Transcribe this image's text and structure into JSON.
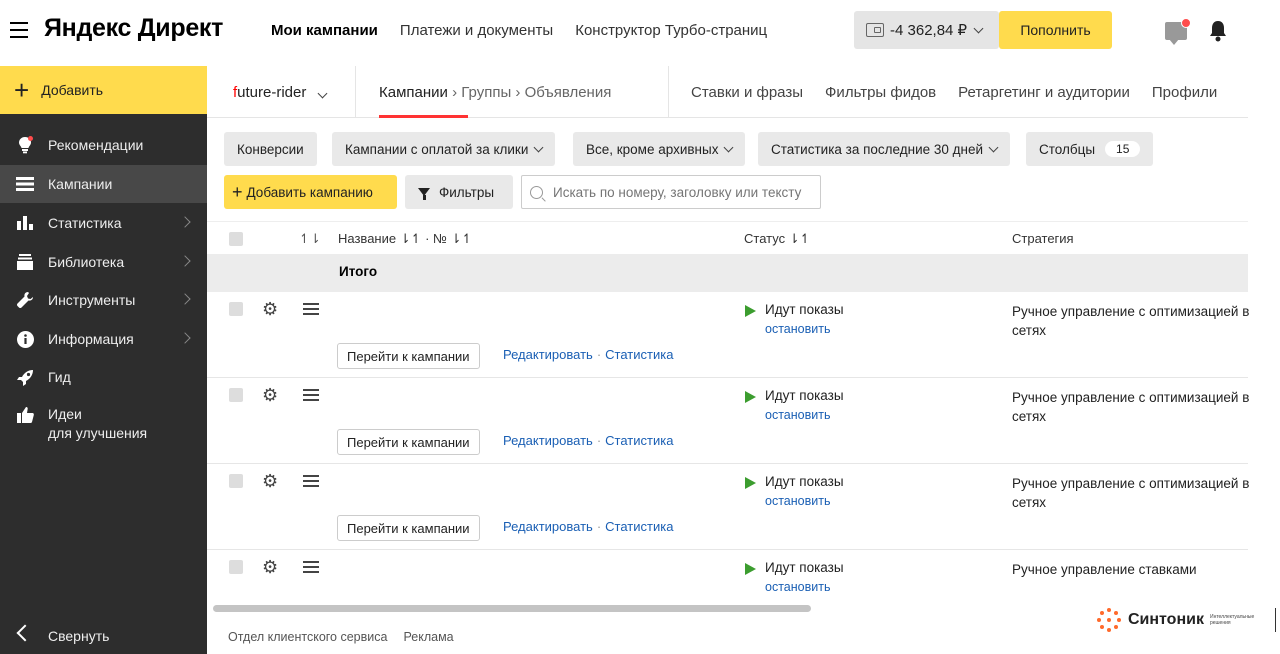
{
  "header": {
    "logo": "Яндекс Директ",
    "nav": [
      "Мои кампании",
      "Платежи и документы",
      "Конструктор Турбо-страниц"
    ],
    "balance": "-4 362,84 ₽",
    "topup_label": "Пополнить"
  },
  "sidebar": {
    "add_label": "Добавить",
    "items": [
      {
        "label": "Рекомендации",
        "icon": "bulb-icon"
      },
      {
        "label": "Кампании",
        "icon": "campaigns-icon"
      },
      {
        "label": "Статистика",
        "icon": "bar-chart-icon"
      },
      {
        "label": "Библиотека",
        "icon": "library-icon"
      },
      {
        "label": "Инструменты",
        "icon": "wrench-icon"
      },
      {
        "label": "Информация",
        "icon": "info-icon"
      },
      {
        "label": "Гид",
        "icon": "rocket-icon"
      },
      {
        "label_line1": "Идеи",
        "label_line2": "для улучшения",
        "icon": "thumbs-up-icon"
      }
    ],
    "collapse_label": "Свернуть"
  },
  "subnav": {
    "login_first": "f",
    "login_rest": "uture-rider",
    "crumb_active": "Кампании",
    "crumb_groups": "Группы",
    "crumb_ads": "Объявления",
    "tabs": [
      "Ставки и фразы",
      "Фильтры фидов",
      "Ретаргетинг и аудитории",
      "Профили"
    ]
  },
  "filters": {
    "conversions": "Конверсии",
    "click_campaigns": "Кампании с оплатой за клики",
    "except_archived": "Все, кроме архивных",
    "stats_period": "Статистика за последние 30 дней",
    "columns": "Столбцы",
    "columns_count": "15",
    "add_campaign": "Добавить кампанию",
    "filters_label": "Фильтры",
    "search_placeholder": "Искать по номеру, заголовку или тексту"
  },
  "table": {
    "sort_col": "↿⇂",
    "name_col": "Название ⇂↿ · № ⇂↿",
    "status_col": "Статус ⇂↿",
    "strategy_col": "Стратегия",
    "total_label": "Итого",
    "rows": [
      {
        "status": "Идут показы",
        "stop": "остановить",
        "strategy": "Ручное управление с оптимизацией в сетях",
        "has_actions": true
      },
      {
        "status": "Идут показы",
        "stop": "остановить",
        "strategy": "Ручное управление с оптимизацией в сетях",
        "has_actions": true
      },
      {
        "status": "Идут показы",
        "stop": "остановить",
        "strategy": "Ручное управление с оптимизацией в сетях",
        "has_actions": true
      },
      {
        "status": "Идут показы",
        "stop": "остановить",
        "strategy": "Ручное управление ставками",
        "has_actions": false
      }
    ],
    "goto_label": "Перейти к кампании",
    "edit_label": "Редактировать",
    "stats_label": "Статистика"
  },
  "footer": {
    "client_service": "Отдел клиентского сервиса",
    "ads": "Реклама"
  },
  "watermark": {
    "brand": "Синтоник",
    "tagline": "Интеллектуальные решения"
  },
  "colors": {
    "accent_yellow": "#ffdb4d",
    "sidebar_bg": "#2d2d2d",
    "link_blue": "#1a5fb4",
    "status_green": "#3c9d2f",
    "active_tab_red": "#ff3333"
  }
}
